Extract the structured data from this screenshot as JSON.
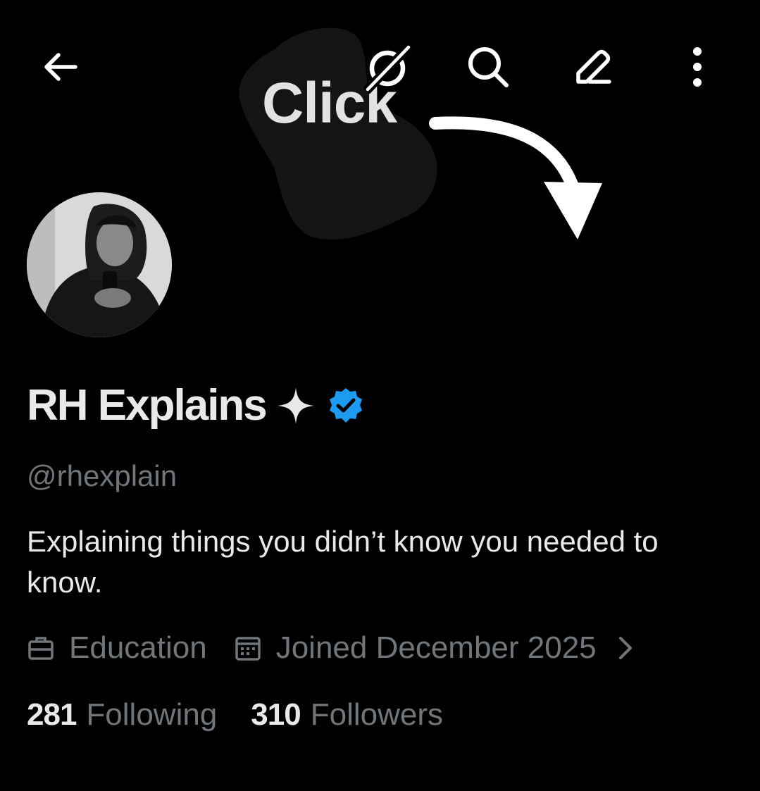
{
  "banner": {
    "text": "Click"
  },
  "topbar": {
    "back_icon": "arrow-left-icon",
    "grok_icon": "grok-icon",
    "search_icon": "search-icon",
    "edit_icon": "edit-pencil-icon",
    "more_icon": "more-vertical-icon"
  },
  "profile": {
    "name": "RH Explains",
    "handle": "@rhexplain",
    "bio": "Explaining things you didn’t know you needed to know.",
    "category": "Education",
    "joined": "Joined December 2025",
    "following_count": "281",
    "following_label": "Following",
    "followers_count": "310",
    "followers_label": "Followers"
  },
  "colors": {
    "background": "#000000",
    "text_primary": "#e7e9ea",
    "text_secondary": "#71767b",
    "verified_blue": "#1d9bf0"
  }
}
